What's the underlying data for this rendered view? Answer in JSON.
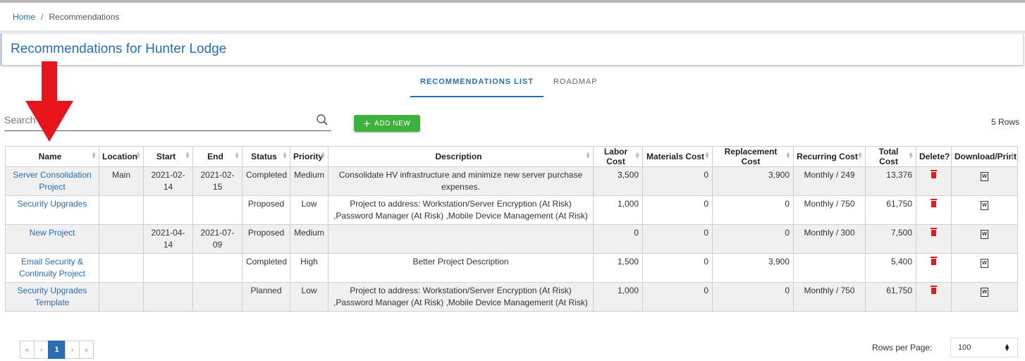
{
  "breadcrumb": {
    "home": "Home",
    "separator": "/",
    "current": "Recommendations"
  },
  "page_title": "Recommendations for Hunter Lodge",
  "tabs": [
    {
      "label": "RECOMMENDATIONS LIST",
      "active": true
    },
    {
      "label": "ROADMAP",
      "active": false
    }
  ],
  "search": {
    "placeholder": "Search",
    "value": ""
  },
  "add_button": {
    "icon": "+",
    "label": "ADD NEW"
  },
  "row_count": "5 Rows",
  "table": {
    "headers": [
      "Name",
      "Location",
      "Start",
      "End",
      "Status",
      "Priority",
      "Description",
      "Labor Cost",
      "Materials Cost",
      "Replacement Cost",
      "Recurring Cost",
      "Total Cost",
      "Delete?",
      "Download/Print"
    ],
    "rows": [
      {
        "name": "Server Consolidation Project",
        "location": "Main",
        "start": "2021-02-14",
        "end": "2021-02-15",
        "status": "Completed",
        "priority": "Medium",
        "description": "Consolidate HV infrastructure and minimize new server purchase expenses.",
        "labor": "3,500",
        "materials": "0",
        "replacement": "3,900",
        "recurring": "Monthly / 249",
        "total": "13,376"
      },
      {
        "name": "Security Upgrades",
        "location": "",
        "start": "",
        "end": "",
        "status": "Proposed",
        "priority": "Low",
        "description": "Project to address: Workstation/Server Encryption (At Risk) ,Password Manager (At Risk) ,Mobile Device Management (At Risk)",
        "labor": "1,000",
        "materials": "0",
        "replacement": "0",
        "recurring": "Monthly / 750",
        "total": "61,750"
      },
      {
        "name": "New Project",
        "location": "",
        "start": "2021-04-14",
        "end": "2021-07-09",
        "status": "Proposed",
        "priority": "Medium",
        "description": "",
        "labor": "0",
        "materials": "0",
        "replacement": "0",
        "recurring": "Monthly / 300",
        "total": "7,500"
      },
      {
        "name": "Email Security & Continuity Project",
        "location": "",
        "start": "",
        "end": "",
        "status": "Completed",
        "priority": "High",
        "description": "Better Project Description",
        "labor": "1,500",
        "materials": "0",
        "replacement": "3,900",
        "recurring": "",
        "total": "5,400"
      },
      {
        "name": "Security Upgrades Template",
        "location": "",
        "start": "",
        "end": "",
        "status": "Planned",
        "priority": "Low",
        "description": "Project to address: Workstation/Server Encryption (At Risk) ,Password Manager (At Risk) ,Mobile Device Management (At Risk)",
        "labor": "1,000",
        "materials": "0",
        "replacement": "0",
        "recurring": "Monthly / 750",
        "total": "61,750"
      }
    ]
  },
  "pagination": {
    "first": "«",
    "prev": "‹",
    "current": "1",
    "next": "›",
    "last": "»"
  },
  "rows_per_page": {
    "label": "Rows per Page:",
    "value": "100"
  },
  "colors": {
    "link": "#2a6db5",
    "add_button": "#3db23d",
    "delete": "#e51b1b",
    "annotation_arrow": "#e8141c"
  },
  "icons": {
    "search": "search-icon",
    "delete": "trash-icon",
    "download": "word-document-icon",
    "annotation": "red-arrow-down"
  }
}
